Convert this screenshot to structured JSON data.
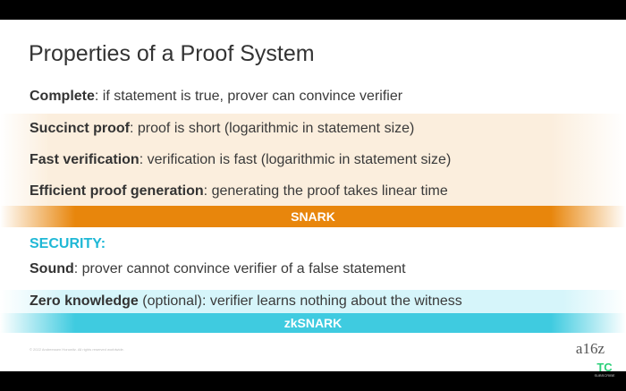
{
  "title": "Properties of a Proof System",
  "properties": [
    {
      "term": "Complete",
      "desc": ": if statement is true, prover can convince verifier"
    },
    {
      "term": "Succinct proof",
      "desc": ": proof is short  (logarithmic in statement size)"
    },
    {
      "term": "Fast verification",
      "desc": ": verification is fast  (logarithmic in statement size)"
    },
    {
      "term": "Efficient proof generation",
      "desc": ": generating the proof takes linear time"
    }
  ],
  "snark_label": "SNARK",
  "security_heading": "SECURITY:",
  "security": [
    {
      "term": "Sound",
      "desc": ": prover cannot convince verifier of a false statement"
    },
    {
      "term": "Zero knowledge",
      "desc": " (optional): verifier learns nothing about the witness"
    }
  ],
  "zksnark_label": "zkSNARK",
  "copyright": "© 2022 Andreessen Horowitz. All rights reserved worldwide.",
  "logo": "a16z",
  "channel": {
    "logo": "TC",
    "subscribe": "SUBSCRIBE"
  },
  "colors": {
    "orange": "#e8860c",
    "cyan": "#3fcbe0"
  }
}
